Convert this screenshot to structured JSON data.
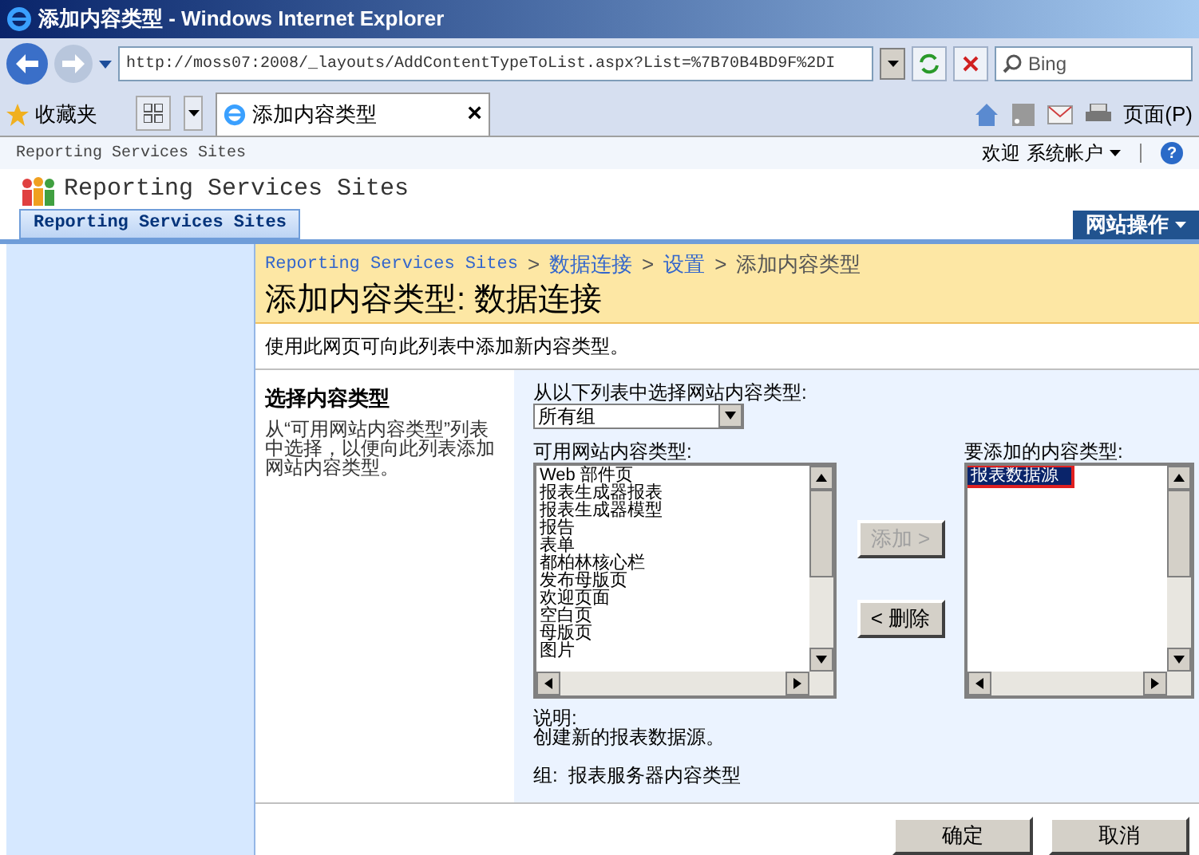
{
  "window": {
    "title": "添加内容类型 - Windows Internet Explorer"
  },
  "address_bar": {
    "url": "http://moss07:2008/_layouts/AddContentTypeToList.aspx?List=%7B70B4BD9F%2DI",
    "search_placeholder": "Bing"
  },
  "favorites_bar": {
    "favorites": "收藏夹",
    "tab": "添加内容类型",
    "tab_close": "×",
    "page_menu": "页面(P)"
  },
  "site_top": {
    "site_link": "Reporting Services Sites",
    "welcome": "欢迎",
    "user": "系统帐户",
    "help": "?"
  },
  "site_header": {
    "title": "Reporting Services Sites",
    "tab": "Reporting Services Sites",
    "site_actions": "网站操作"
  },
  "breadcrumb": [
    {
      "label": "Reporting Services Sites",
      "link": true
    },
    {
      "label": "数据连接",
      "link": true
    },
    {
      "label": "设置",
      "link": true
    },
    {
      "label": "添加内容类型",
      "link": false
    }
  ],
  "breadcrumb_separator": ">",
  "page_title": "添加内容类型: 数据连接",
  "page_description": "使用此网页可向此列表中添加新内容类型。",
  "section": {
    "title": "选择内容类型",
    "description": "从“可用网站内容类型”列表中选择，以便向此列表添加网站内容类型。"
  },
  "group_select": {
    "label": "从以下列表中选择网站内容类型:",
    "value": "所有组"
  },
  "available": {
    "label": "可用网站内容类型:",
    "items": [
      {
        "label": "Web 部件页",
        "selected": false
      },
      {
        "label": "报表生成器报表",
        "selected": false
      },
      {
        "label": "报表生成器模型",
        "selected": false
      },
      {
        "label": "报告",
        "selected": false
      },
      {
        "label": "表单",
        "selected": false
      },
      {
        "label": "都柏林核心栏",
        "selected": false
      },
      {
        "label": "发布母版页",
        "selected": false
      },
      {
        "label": "欢迎页面",
        "selected": false
      },
      {
        "label": "空白页",
        "selected": false
      },
      {
        "label": "母版页",
        "selected": false
      },
      {
        "label": "图片",
        "selected": false
      }
    ]
  },
  "add_button": {
    "label": "添加 >",
    "disabled": true
  },
  "remove_button": {
    "label": "< 删除",
    "disabled": false
  },
  "to_add": {
    "label": "要添加的内容类型:",
    "items": [
      {
        "label": "报表数据源",
        "selected": true,
        "highlighted": true
      }
    ]
  },
  "details": {
    "description_label": "说明:",
    "description": "创建新的报表数据源。",
    "group": "组:  报表服务器内容类型"
  },
  "buttons": [
    {
      "label": "确定"
    },
    {
      "label": "取消"
    }
  ]
}
